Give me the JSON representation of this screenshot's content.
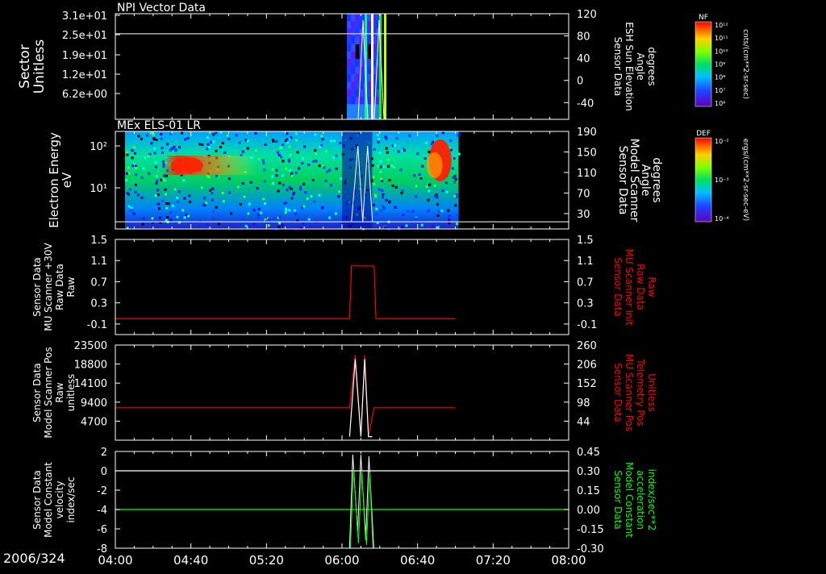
{
  "date_label": "2006/324",
  "x_ticks": [
    "04:00",
    "04:40",
    "05:20",
    "06:00",
    "06:40",
    "07:20",
    "08:00"
  ],
  "chart_data": [
    {
      "type": "heatmap",
      "title": "NPI Vector Data",
      "ylabel_lines": [
        "Sector",
        "Unitless"
      ],
      "y_ticks": [
        "3.1e+01",
        "2.5e+01",
        "1.9e+01",
        "1.2e+01",
        "6.2e+00"
      ],
      "y2label_lines": [
        "Sensor Data",
        "ESH Sun Elevation",
        "Angle",
        "degrees"
      ],
      "y2_ticks": [
        "120",
        "80",
        "40",
        "0",
        "-40"
      ],
      "colorbar": {
        "label": "NF",
        "unit": "cnts/(cm**2-sr-sec)",
        "ticks": [
          "10¹²",
          "10¹¹",
          "10¹⁰",
          "10⁹",
          "10⁸",
          "10⁷",
          "10⁶"
        ]
      },
      "data_window": {
        "start": "06:00",
        "end": "06:20"
      },
      "overlay_line": {
        "y2_value": 84
      }
    },
    {
      "type": "heatmap",
      "title": "MEx ELS-01 LR",
      "ylabel_lines": [
        "Electron Energy",
        "eV"
      ],
      "y_ticks": [
        "10²",
        "10¹"
      ],
      "y2label_lines": [
        "Sensor Data",
        "Model Scanner",
        "Angle",
        "degrees"
      ],
      "y2_ticks": [
        "190",
        "150",
        "110",
        "70",
        "30"
      ],
      "colorbar": {
        "label": "DEF",
        "unit": "ergs/(cm**2-sr-sec-eV)",
        "ticks": [
          "10⁻²",
          "10⁻³",
          "10⁻⁴"
        ]
      },
      "data_window": {
        "start": "04:00",
        "end": "07:00"
      },
      "overlay_line": {
        "y2_value": 14
      }
    },
    {
      "type": "line",
      "ylabel_lines": [
        "Sensor Data",
        "MU Scanner +30V",
        "Raw Data",
        "Raw"
      ],
      "y_ticks": [
        "1.5",
        "1.1",
        "0.7",
        "0.3",
        "-0.1"
      ],
      "ylim": [
        -0.3,
        1.5
      ],
      "y2label_lines": [
        "Sensor Data",
        "MU Scanner Init",
        "Raw Data",
        "Raw"
      ],
      "y2_ticks": [
        "1.5",
        "1.1",
        "0.7",
        "0.3",
        "-0.1"
      ],
      "series": [
        {
          "color": "#ff0000",
          "x": [
            "04:00",
            "06:04",
            "06:05",
            "06:17",
            "06:18",
            "07:00"
          ],
          "y": [
            0,
            0,
            1,
            1,
            0,
            0
          ]
        }
      ]
    },
    {
      "type": "line",
      "ylabel_lines": [
        "Sensor Data",
        "Model Scanner Pos",
        "Raw",
        "unitless"
      ],
      "y_ticks": [
        "23500",
        "18800",
        "14100",
        "9400",
        "4700"
      ],
      "ylim": [
        0,
        23500
      ],
      "y2label_lines": [
        "Sensor Data",
        "MU Scanner Pos",
        "Telemetry Pos",
        "Unitless"
      ],
      "y2_ticks": [
        "260",
        "206",
        "152",
        "98",
        "44"
      ],
      "y2lim": [
        -10,
        260
      ],
      "series": [
        {
          "color": "#ff0000",
          "x": [
            "04:00",
            "06:04",
            "06:07",
            "06:10",
            "06:12",
            "06:14",
            "06:17",
            "07:00"
          ],
          "y": [
            8000,
            8000,
            21000,
            1000,
            21000,
            1000,
            8000,
            8000
          ]
        },
        {
          "color": "#ffffff",
          "axis": "y2",
          "x": [
            "06:04",
            "06:07",
            "06:10",
            "06:12",
            "06:14",
            "06:16"
          ],
          "y": [
            0,
            220,
            0,
            220,
            0,
            0
          ]
        }
      ]
    },
    {
      "type": "line",
      "ylabel_lines": [
        "Sensor Data",
        "Model Constant",
        "velocity",
        "index/sec"
      ],
      "y_ticks": [
        "2",
        "0",
        "-2",
        "-4",
        "-6",
        "-8"
      ],
      "ylim": [
        -8,
        2
      ],
      "y2label_lines": [
        "Sensor Data",
        "Model Constant",
        "acceleration",
        "index/sec**2"
      ],
      "y2_ticks": [
        "0.45",
        "0.30",
        "0.15",
        "0.00",
        "-0.15",
        "-0.30"
      ],
      "y2lim": [
        -0.3,
        0.45
      ],
      "series": [
        {
          "color": "#ffffff",
          "x": [
            "04:00",
            "08:00"
          ],
          "y": [
            0,
            0
          ]
        },
        {
          "color": "#00ff00",
          "axis": "y2",
          "x": [
            "04:00",
            "08:00"
          ],
          "y": [
            0,
            0
          ]
        }
      ]
    }
  ],
  "colors": {
    "background": "#000000",
    "axes": "#ffffff",
    "red_trace": "#ff0000",
    "green_trace": "#00ff00"
  }
}
